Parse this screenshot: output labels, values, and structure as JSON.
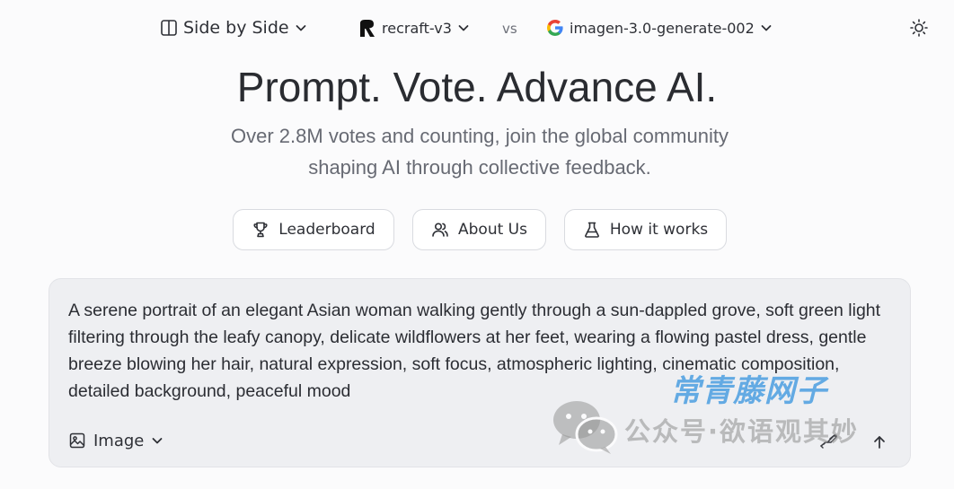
{
  "topbar": {
    "mode": {
      "label": "Side by Side",
      "icon": "columns-icon"
    },
    "model_a": {
      "label": "recraft-v3",
      "icon": "recraft-logo-icon"
    },
    "vs": "vs",
    "model_b": {
      "label": "imagen-3.0-generate-002",
      "icon": "google-logo-icon"
    },
    "theme_icon": "sun-icon"
  },
  "hero": {
    "title": "Prompt. Vote. Advance AI.",
    "subtitle": "Over 2.8M votes and counting, join the global community shaping AI through collective feedback."
  },
  "nav": {
    "leaderboard": {
      "label": "Leaderboard",
      "icon": "trophy-icon"
    },
    "about": {
      "label": "About Us",
      "icon": "users-icon"
    },
    "how": {
      "label": "How it works",
      "icon": "flask-icon"
    }
  },
  "prompt": {
    "text": "A serene portrait of an elegant Asian woman walking gently through a sun-dappled grove, soft green light filtering through the leafy canopy, delicate wildflowers at her feet, wearing a flowing pastel dress, gentle breeze blowing her hair, natural expression, soft focus, atmospheric lighting, cinematic composition, detailed background, peaceful mood",
    "modality": {
      "label": "Image",
      "icon": "image-icon"
    },
    "hand_icon": "hand-icon",
    "send_icon": "arrow-up-icon"
  },
  "watermark": {
    "brand": "常青藤网子",
    "text": "公众号·欲语观其妙"
  },
  "colors": {
    "background": "#fbfbfc",
    "prompt_bg": "#eeeff2",
    "border": "#d9dbe0",
    "text": "#2b2d33",
    "muted": "#676a73",
    "watermark_blue": "#4a9ee0"
  }
}
